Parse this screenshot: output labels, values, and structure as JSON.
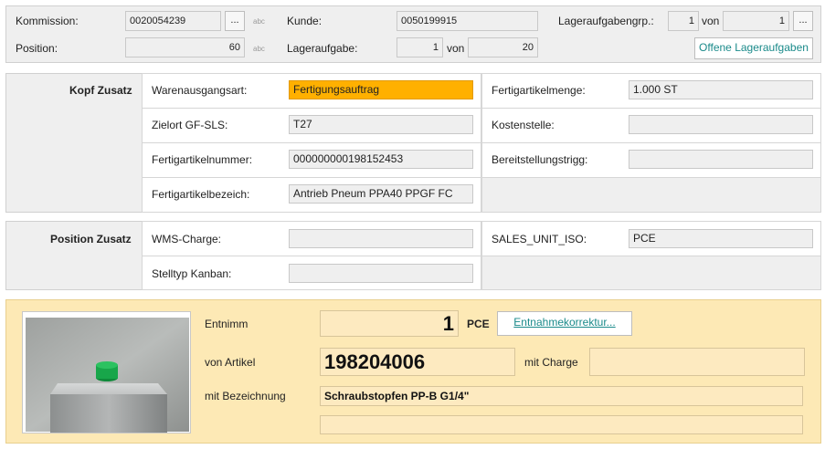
{
  "header": {
    "kommission_label": "Kommission:",
    "kommission_value": "0020054239",
    "kunde_label": "Kunde:",
    "kunde_value": "0050199915",
    "lagergrp_label": "Lageraufgabengrp.:",
    "lagergrp_value": "1",
    "lagergrp_von_label": "von",
    "lagergrp_von_value": "1",
    "position_label": "Position:",
    "position_value": "60",
    "lageraufgabe_label": "Lageraufgabe:",
    "lageraufgabe_value": "1",
    "lageraufgabe_von_label": "von",
    "lageraufgabe_von_value": "20",
    "more_label": "...",
    "abc_label": "abc",
    "offene_button": "Offene Lageraufgaben"
  },
  "kopf": {
    "title": "Kopf Zusatz",
    "warenausgangsart_label": "Warenausgangsart:",
    "warenausgangsart_value": "Fertigungsauftrag",
    "zielort_label": "Zielort GF-SLS:",
    "zielort_value": "T27",
    "fertigartikelnummer_label": "Fertigartikelnummer:",
    "fertigartikelnummer_value": "000000000198152453",
    "fertigartikelbezeich_label": "Fertigartikelbezeich:",
    "fertigartikelbezeich_value": "Antrieb Pneum PPA40 PPGF FC",
    "fertigartikelmenge_label": "Fertigartikelmenge:",
    "fertigartikelmenge_value": "1.000 ST",
    "kostenstelle_label": "Kostenstelle:",
    "kostenstelle_value": "",
    "bereitstellung_label": "Bereitstellungstrigg:",
    "bereitstellung_value": ""
  },
  "position": {
    "title": "Position Zusatz",
    "wms_label": "WMS-Charge:",
    "wms_value": "",
    "stelltyp_label": "Stelltyp Kanban:",
    "stelltyp_value": "",
    "sales_unit_label": "SALES_UNIT_ISO:",
    "sales_unit_value": "PCE"
  },
  "entnahme": {
    "entnimm_label": "Entnimm",
    "quantity": "1",
    "unit": "PCE",
    "korrektur_button": "Entnahmekorrektur...",
    "von_artikel_label": "von Artikel",
    "artikel_value": "198204006",
    "mit_charge_label": "mit Charge",
    "charge_value": "",
    "mit_bezeichnung_label": "mit Bezeichnung",
    "bezeichnung_value": "Schraubstopfen PP-B G1/4\"",
    "bezeichnung2_value": ""
  },
  "colors": {
    "highlight": "#ffb000",
    "entnahme_bg": "#fde9b5",
    "link": "#1a8a8a"
  }
}
